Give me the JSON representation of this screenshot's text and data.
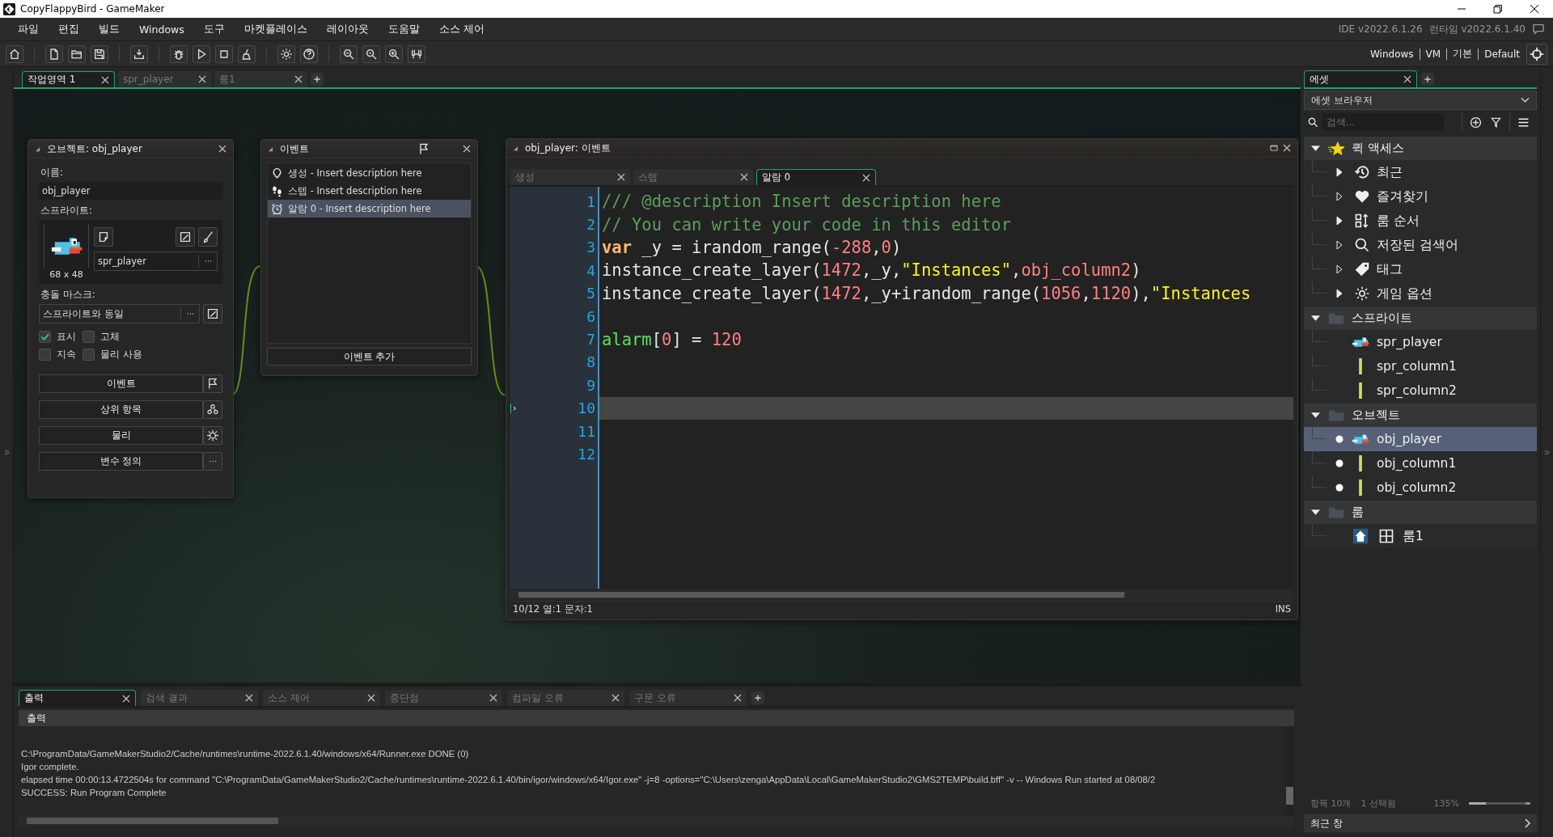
{
  "window": {
    "title": "CopyFlappyBird - GameMaker"
  },
  "menu": [
    "파일",
    "편집",
    "빌드",
    "Windows",
    "도구",
    "마켓플레이스",
    "레이아웃",
    "도움말",
    "소스 제어"
  ],
  "version": {
    "ide": "IDE v2022.6.1.26",
    "runtime": "런타임 v2022.6.1.40"
  },
  "targets": [
    "Windows",
    "VM",
    "기본",
    "Default"
  ],
  "workspace_tabs": [
    {
      "label": "작업영역 1",
      "selected": true
    },
    {
      "label": "spr_player",
      "selected": false
    },
    {
      "label": "룸1",
      "selected": false
    }
  ],
  "object_window": {
    "title": "오브젝트: obj_player",
    "name_label": "이름:",
    "name": "obj_player",
    "sprite_label": "스프라이트:",
    "sprite": "spr_player",
    "sprite_size": "68 x 48",
    "mask_label": "충돌 마스크:",
    "mask": "스프라이트와 동일",
    "options": [
      {
        "label": "표시",
        "checked": true
      },
      {
        "label": "고체",
        "checked": false
      },
      {
        "label": "지속",
        "checked": false
      },
      {
        "label": "물리 사용",
        "checked": false
      }
    ],
    "buttons": [
      {
        "label": "이벤트",
        "kind": "flag"
      },
      {
        "label": "상위 항목",
        "kind": "parent"
      },
      {
        "label": "물리",
        "kind": "physics"
      },
      {
        "label": "변수 정의",
        "kind": "more"
      }
    ]
  },
  "events_window": {
    "title": "이벤트",
    "events": [
      {
        "kind": "create",
        "label": "생성 - Insert description here",
        "selected": false
      },
      {
        "kind": "step",
        "label": "스텝 - Insert description here",
        "selected": false
      },
      {
        "kind": "alarm",
        "label": "알람 0 - Insert description here",
        "selected": true
      }
    ],
    "add_button": "이벤트 추가"
  },
  "code_window": {
    "title": "obj_player: 이벤트",
    "tabs": [
      {
        "label": "생성",
        "selected": false
      },
      {
        "label": "스텝",
        "selected": false
      },
      {
        "label": "알람 0",
        "selected": true
      }
    ],
    "lines": [
      {
        "number": "1",
        "selected": false,
        "tokens": [
          {
            "kind": "comment",
            "text": "/// @description Insert description here"
          }
        ]
      },
      {
        "number": "2",
        "selected": false,
        "tokens": [
          {
            "kind": "comment",
            "text": "// You can write your code in this editor"
          }
        ]
      },
      {
        "number": "3",
        "selected": false,
        "tokens": [
          {
            "kind": "keyword",
            "text": "var"
          },
          {
            "kind": "plain",
            "text": " _y = irandom_range("
          },
          {
            "kind": "number",
            "text": "-288"
          },
          {
            "kind": "plain",
            "text": ","
          },
          {
            "kind": "number",
            "text": "0"
          },
          {
            "kind": "plain",
            "text": ")"
          }
        ]
      },
      {
        "number": "4",
        "selected": false,
        "tokens": [
          {
            "kind": "plain",
            "text": "instance_create_layer("
          },
          {
            "kind": "number",
            "text": "1472"
          },
          {
            "kind": "plain",
            "text": ",_y,"
          },
          {
            "kind": "string",
            "text": "\"Instances\""
          },
          {
            "kind": "plain",
            "text": ","
          },
          {
            "kind": "asset",
            "text": "obj_column2"
          },
          {
            "kind": "plain",
            "text": ")"
          }
        ]
      },
      {
        "number": "5",
        "selected": false,
        "tokens": [
          {
            "kind": "plain",
            "text": "instance_create_layer("
          },
          {
            "kind": "number",
            "text": "1472"
          },
          {
            "kind": "plain",
            "text": ",_y+irandom_range("
          },
          {
            "kind": "number",
            "text": "1056"
          },
          {
            "kind": "plain",
            "text": ","
          },
          {
            "kind": "number",
            "text": "1120"
          },
          {
            "kind": "plain",
            "text": "),"
          },
          {
            "kind": "string",
            "text": "\"Instances"
          }
        ]
      },
      {
        "number": "6",
        "selected": false
      },
      {
        "number": "7",
        "selected": false,
        "tokens": [
          {
            "kind": "builtin",
            "text": "alarm"
          },
          {
            "kind": "plain",
            "text": "["
          },
          {
            "kind": "number",
            "text": "0"
          },
          {
            "kind": "plain",
            "text": "] = "
          },
          {
            "kind": "number",
            "text": "120"
          }
        ]
      },
      {
        "number": "8",
        "selected": false
      },
      {
        "number": "9",
        "selected": false
      },
      {
        "number": "10",
        "selected": true
      },
      {
        "number": "11",
        "selected": false
      },
      {
        "number": "12",
        "selected": false
      }
    ],
    "status": "10/12 열:1 문자:1",
    "mode": "INS"
  },
  "output": {
    "tabs": [
      {
        "label": "출력",
        "selected": true
      },
      {
        "label": "검색 결과",
        "selected": false
      },
      {
        "label": "소스 제어",
        "selected": false
      },
      {
        "label": "중단점",
        "selected": false
      },
      {
        "label": "컴파일 오류",
        "selected": false
      },
      {
        "label": "구문 오류",
        "selected": false
      }
    ],
    "header": "출력",
    "log": [
      "C:\\ProgramData/GameMakerStudio2/Cache/runtimes\\runtime-2022.6.1.40/windows/x64/Runner.exe DONE (0)",
      "Igor complete.",
      "elapsed time 00:00:13.4722504s for command \"C:\\ProgramData/GameMakerStudio2/Cache/runtimes\\runtime-2022.6.1.40/bin/igor/windows/x64/Igor.exe\" -j=8 -options=\"C:\\Users\\zenga\\AppData\\Local\\GameMakerStudio2\\GMS2TEMP\\build.bff\" -v -- Windows Run started at 08/08/2",
      "SUCCESS: Run Program Complete"
    ]
  },
  "assets": {
    "tab": "에셋",
    "browser": "에셋 브라우저",
    "search_placeholder": "검색...",
    "tree": [
      {
        "label": "퀵 액세스",
        "kind": "quick",
        "expanded": true,
        "children": [
          {
            "label": "최근",
            "kind": "recent",
            "empty": false
          },
          {
            "label": "즐겨찾기",
            "kind": "favorites",
            "empty": true
          },
          {
            "label": "룸 순서",
            "kind": "room_order",
            "empty": false
          },
          {
            "label": "저장된 검색어",
            "kind": "saved_search",
            "empty": true
          },
          {
            "label": "태그",
            "kind": "tags",
            "empty": true
          },
          {
            "label": "게임 옵션",
            "kind": "game_options",
            "empty": false
          }
        ]
      },
      {
        "label": "스프라이트",
        "kind": "folder",
        "expanded": true,
        "children": [
          {
            "label": "spr_player",
            "kind": "bird",
            "dot": false,
            "selected": false
          },
          {
            "label": "spr_column1",
            "kind": "column",
            "dot": false,
            "selected": false
          },
          {
            "label": "spr_column2",
            "kind": "column",
            "dot": false,
            "selected": false
          }
        ]
      },
      {
        "label": "오브젝트",
        "kind": "folder",
        "expanded": true,
        "children": [
          {
            "label": "obj_player",
            "kind": "bird",
            "dot": true,
            "selected": true
          },
          {
            "label": "obj_column1",
            "kind": "column",
            "dot": true,
            "selected": false
          },
          {
            "label": "obj_column2",
            "kind": "column",
            "dot": true,
            "selected": false
          }
        ]
      },
      {
        "label": "룸",
        "kind": "folder",
        "expanded": true,
        "children": [
          {
            "label": "룸1",
            "kind": "room",
            "dot": false,
            "selected": false
          }
        ]
      }
    ],
    "count": "항목 10개",
    "selection": "1 선택됨",
    "zoom": "135%",
    "zoom_slider": {
      "level": 0.3
    },
    "recent_windows": "최근 창"
  }
}
